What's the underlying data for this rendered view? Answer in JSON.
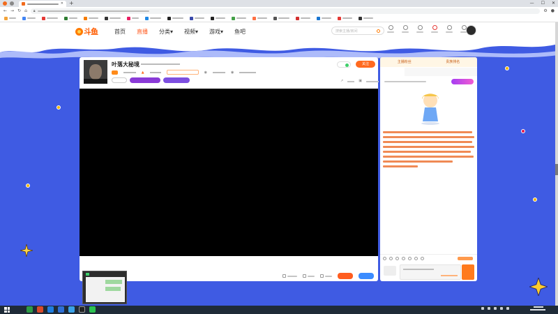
{
  "site": {
    "brand": "斗鱼",
    "nav": [
      "首页",
      "直播",
      "分类▾",
      "视频▾",
      "游戏▾",
      "鱼吧"
    ],
    "search_placeholder": "搜索主播/房间"
  },
  "room": {
    "title": "叶落大秘境",
    "follow_label": "关注"
  },
  "side": {
    "tab_left": "主播粉丝",
    "tab_right": "贵族排名"
  },
  "colors": {
    "page_bg": "#3f5be3",
    "accent_orange": "#ff5d23",
    "blue_button": "#3b8cff",
    "purple_pill": "#8a3bd7",
    "notice_text": "#f08a55"
  },
  "icons": [
    "back-icon",
    "forward-icon",
    "reload-icon",
    "home-icon",
    "search-icon",
    "gear-icon",
    "close-icon",
    "windows-start-icon"
  ]
}
